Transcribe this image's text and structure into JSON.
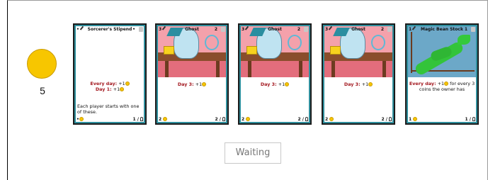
{
  "player": {
    "coins": "5",
    "coin_color": "#f7c600"
  },
  "status_button": "Waiting",
  "cards": [
    {
      "cost": "•",
      "name": "Sorcerer's Stipend",
      "duration": "•",
      "effect_lines": [
        {
          "label": "Every day:",
          "value": "+1"
        },
        {
          "label": "Day 1:",
          "value": "+1"
        }
      ],
      "description": "Each player starts with one of these.",
      "foot_left": "•",
      "foot_right": "1 /"
    },
    {
      "cost": "3",
      "name": "Ghost",
      "duration": "2",
      "effect_lines": [
        {
          "label": "Day 3:",
          "value": "+1"
        }
      ],
      "description": "",
      "foot_left": "2",
      "foot_right": "2 /"
    },
    {
      "cost": "3",
      "name": "Ghost",
      "duration": "2",
      "effect_lines": [
        {
          "label": "Day 3:",
          "value": "+1"
        }
      ],
      "description": "",
      "foot_left": "2",
      "foot_right": "2 /"
    },
    {
      "cost": "3",
      "name": "Ghost",
      "duration": "2",
      "effect_lines": [
        {
          "label": "Day 3:",
          "value": "+1"
        }
      ],
      "description": "",
      "foot_left": "2",
      "foot_right": "2 /"
    },
    {
      "cost": "1",
      "name": "Magic Bean Stock",
      "duration": "1",
      "effect_lines": [
        {
          "label": "Every day:",
          "value": "+1",
          "suffix": "for every 3 coins the owner has"
        }
      ],
      "description": "",
      "foot_left": "1",
      "foot_right": "1 /"
    }
  ]
}
